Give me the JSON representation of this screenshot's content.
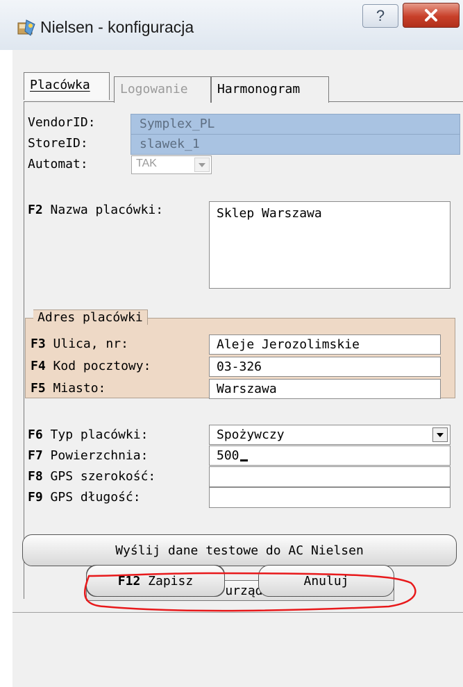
{
  "window": {
    "title": "Nielsen - konfiguracja",
    "help_glyph": "?",
    "icons": {
      "app": "app-icon",
      "help": "help-icon",
      "close": "close-icon"
    }
  },
  "tabs": [
    {
      "label": "Placówka",
      "state": "active"
    },
    {
      "label": "Logowanie",
      "state": "disabled"
    },
    {
      "label": "Harmonogram",
      "state": "normal"
    }
  ],
  "fields": {
    "vendor_id": {
      "label": "VendorID:",
      "value": "Symplex_PL"
    },
    "store_id": {
      "label": "StoreID:",
      "value": "slawek_1"
    },
    "automat": {
      "label": "Automat:",
      "value": "TAK"
    },
    "store_name": {
      "key": "F2",
      "label": "Nazwa placówki:",
      "value": "Sklep Warszawa"
    }
  },
  "address": {
    "legend": "Adres placówki",
    "street": {
      "key": "F3",
      "label": "Ulica, nr:",
      "value": "Aleje Jerozolimskie"
    },
    "postal_code": {
      "key": "F4",
      "label": "Kod pocztowy:",
      "value": "03-326"
    },
    "city": {
      "key": "F5",
      "label": "Miasto:",
      "value": "Warszawa"
    }
  },
  "details": {
    "type": {
      "key": "F6",
      "label": "Typ placówki:",
      "value": "Spożywczy"
    },
    "area": {
      "key": "F7",
      "label": "Powierzchnia:",
      "value": "500"
    },
    "gps_lat": {
      "key": "F8",
      "label": "GPS szerokość:",
      "value": ""
    },
    "gps_lon": {
      "key": "F9",
      "label": "GPS długość:",
      "value": ""
    }
  },
  "buttons": {
    "send_test": "Wyślij dane testowe do AC Nielsen",
    "show_devices": "Wskaż urządzenia",
    "save_key": "F12",
    "save_label": "Zapisz",
    "cancel_label": "Anuluj"
  },
  "colors": {
    "readonly_field": "#a9c3e2",
    "address_box": "#eed9c6",
    "close_button": "#c8402a",
    "annotation": "#e8191b"
  }
}
